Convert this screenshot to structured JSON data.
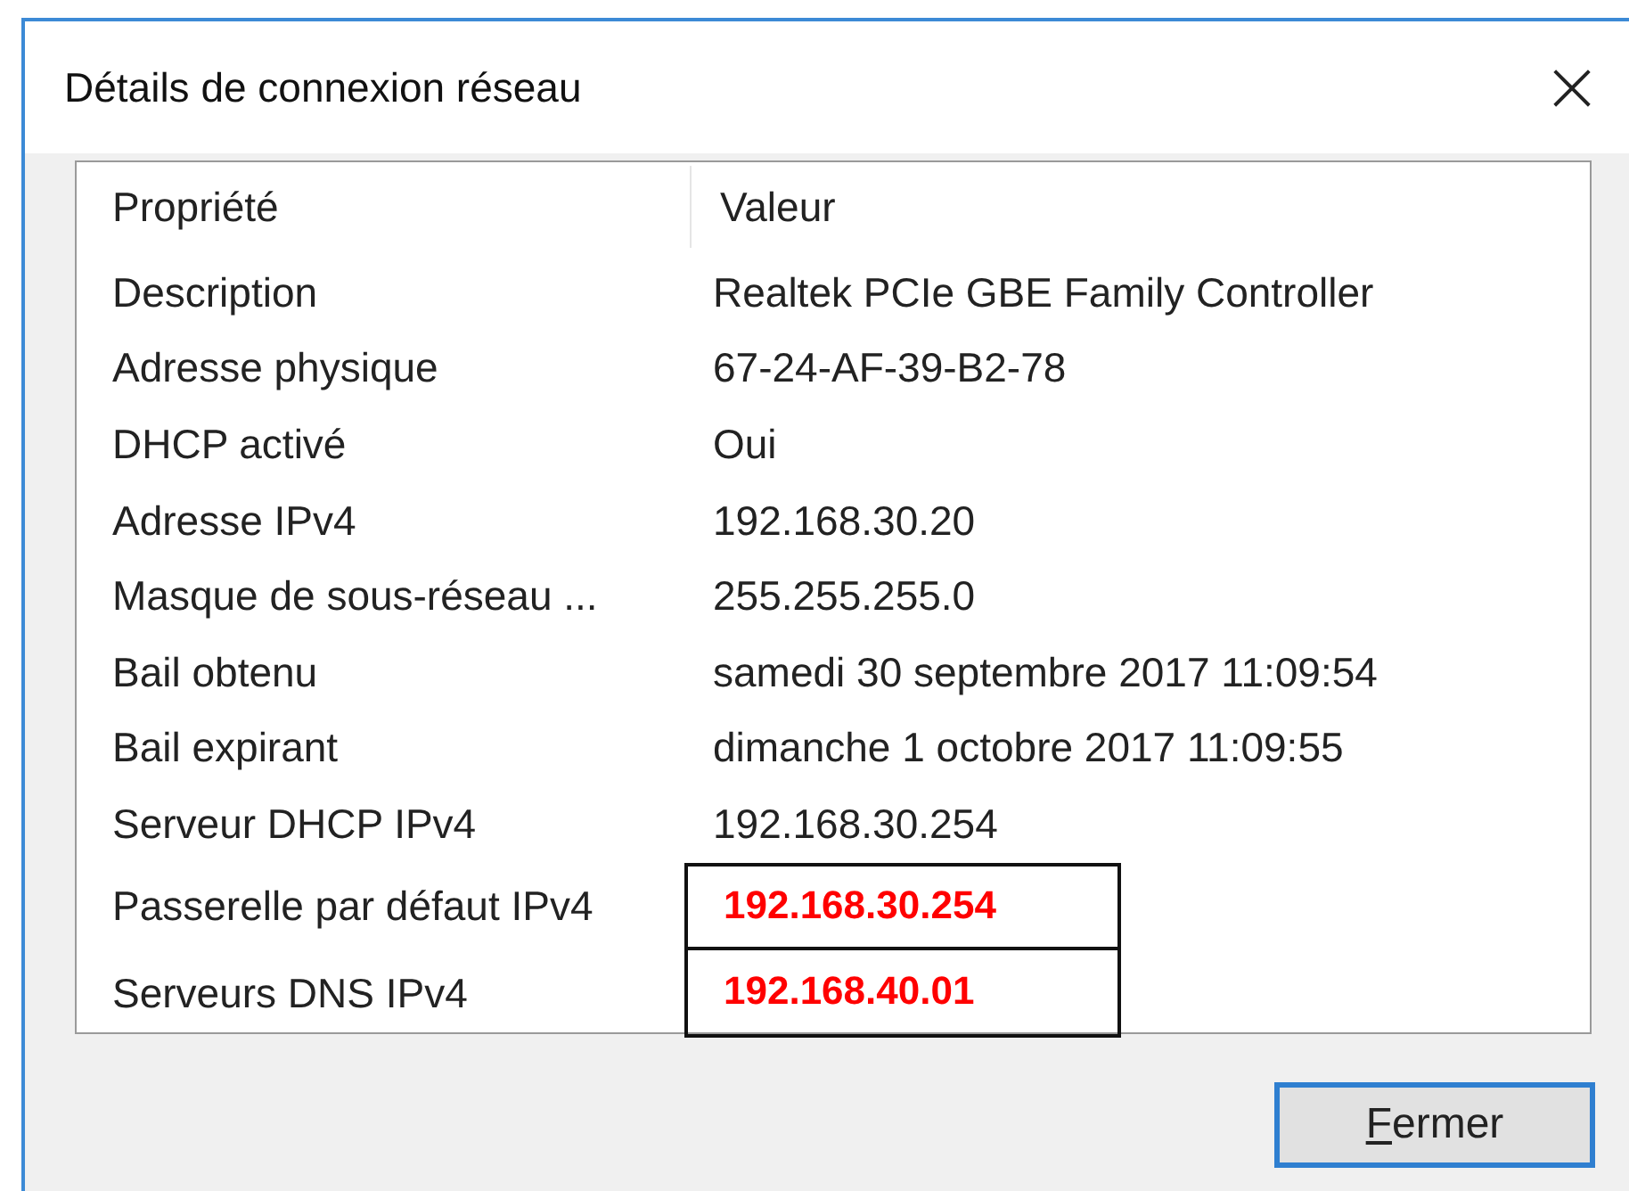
{
  "window": {
    "title": "Détails de connexion réseau",
    "close": "×"
  },
  "table": {
    "columns": [
      "Propriété",
      "Valeur"
    ],
    "rows": [
      {
        "property": "Description",
        "value": "Realtek PCIe GBE Family Controller",
        "highlighted": false
      },
      {
        "property": "Adresse physique",
        "value": "67-24-AF-39-B2-78",
        "highlighted": false
      },
      {
        "property": "DHCP activé",
        "value": "Oui",
        "highlighted": false
      },
      {
        "property": "Adresse IPv4",
        "value": "192.168.30.20",
        "highlighted": false
      },
      {
        "property": "Masque de sous-réseau ...",
        "value": "255.255.255.0",
        "highlighted": false
      },
      {
        "property": "Bail obtenu",
        "value": "samedi 30 septembre 2017 11:09:54",
        "highlighted": false
      },
      {
        "property": "Bail expirant",
        "value": "dimanche 1 octobre 2017 11:09:55",
        "highlighted": false
      },
      {
        "property": "Serveur DHCP IPv4",
        "value": "192.168.30.254",
        "highlighted": false
      },
      {
        "property": "Passerelle par défaut IPv4",
        "value": "192.168.30.254",
        "highlighted": true
      },
      {
        "property": "Serveurs DNS IPv4",
        "value": "192.168.40.01",
        "highlighted": true
      }
    ]
  },
  "buttons": [
    {
      "label": "Fermer",
      "default": true
    }
  ]
}
